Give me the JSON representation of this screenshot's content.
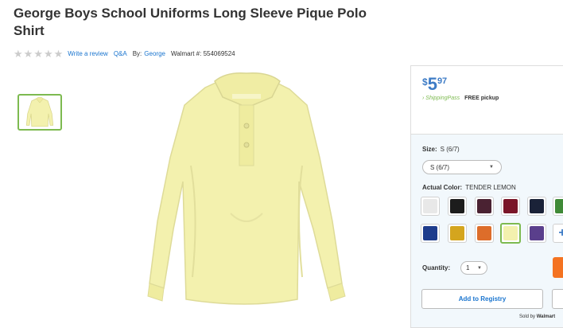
{
  "product": {
    "title": "George Boys School Uniforms Long Sleeve Pique Polo Shirt",
    "rating_stars": 0,
    "write_review": "Write a review",
    "qa": "Q&A",
    "by_label": "By:",
    "brand": "George",
    "walmart_label": "Walmart #:",
    "walmart_number": "554069524"
  },
  "buybox": {
    "price_currency": "$",
    "price_dollars": "5",
    "price_cents": "97",
    "shipping_pass": "ShippingPass",
    "free_pickup": "FREE pickup",
    "size_label": "Size:",
    "size_value": "S (6/7)",
    "size_select": "S (6/7)",
    "color_label": "Actual Color:",
    "color_value": "TENDER LEMON",
    "quantity_label": "Quantity:",
    "quantity_value": "1",
    "registry_label": "Add to Registry",
    "sold_by_label": "Sold by",
    "sold_by_value": "Walmart"
  },
  "colors": {
    "accent_blue": "#3e7cc6",
    "link_blue": "#1a75cf",
    "green": "#7dba50",
    "shirt": "#f3f1ae",
    "orange": "#f47321"
  },
  "swatches": [
    {
      "name": "white",
      "color": "#e8e8e8"
    },
    {
      "name": "black",
      "color": "#1c1c1c"
    },
    {
      "name": "burgundy",
      "color": "#4a2232"
    },
    {
      "name": "red-wine",
      "color": "#7a1528"
    },
    {
      "name": "navy",
      "color": "#1a2238"
    },
    {
      "name": "green",
      "color": "#3f8a37"
    },
    {
      "name": "royal-blue",
      "color": "#1e3c8c"
    },
    {
      "name": "gold",
      "color": "#d4a51e"
    },
    {
      "name": "orange",
      "color": "#dd6d2a"
    },
    {
      "name": "tender-lemon",
      "color": "#f3f1ae"
    },
    {
      "name": "purple",
      "color": "#5a3f8c"
    }
  ]
}
